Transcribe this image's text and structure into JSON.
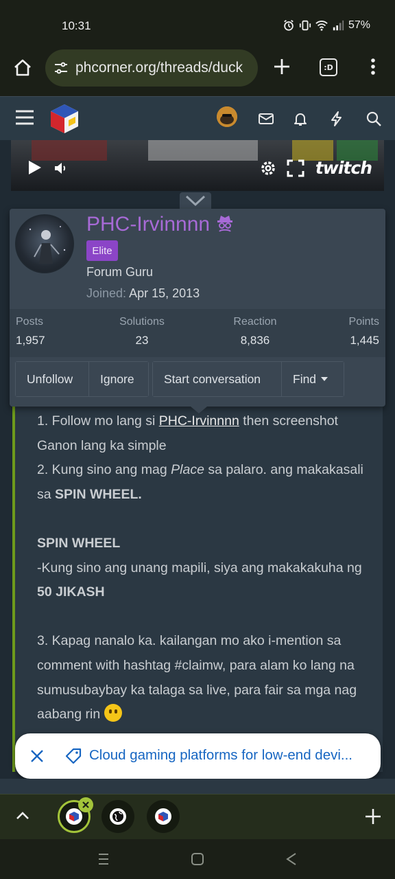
{
  "status": {
    "time": "10:31",
    "battery": "57%"
  },
  "browser": {
    "url": "phcorner.org/threads/duck",
    "tab_icon_label": ":D"
  },
  "video": {
    "brand": "twitch"
  },
  "user_card": {
    "username": "PHC-Irvinnnn",
    "badge": "Elite",
    "title": "Forum Guru",
    "joined_label": "Joined:",
    "joined_date": "Apr 15, 2013",
    "stats": [
      {
        "label": "Posts",
        "value": "1,957"
      },
      {
        "label": "Solutions",
        "value": "23"
      },
      {
        "label": "Reaction",
        "value": "8,836"
      },
      {
        "label": "Points",
        "value": "1,445"
      }
    ],
    "buttons": {
      "unfollow": "Unfollow",
      "ignore": "Ignore",
      "start_conversation": "Start conversation",
      "find": "Find"
    }
  },
  "post": {
    "l1a": "1. Follow mo lang si ",
    "l1_link": "PHC-Irvinnnn",
    "l1b": " then screenshot Ganon lang ka simple",
    "l2a": "2. Kung sino ang mag ",
    "l2_em": "Place",
    "l2b": " sa palaro. ang makakasali sa ",
    "l2_bold": "SPIN WHEEL.",
    "spin_heading": "SPIN WHEEL",
    "spin_a": "-Kung sino ang unang mapili, siya ang makakakuha ng ",
    "spin_bold": "50 JIKASH",
    "l3": "3. Kapag nanalo ka. kailangan mo ako i-mention sa comment with hashtag #claimw, para alam ko lang na sumusubaybay ka talaga sa live, para fair sa mga nag aabang rin "
  },
  "suggestion": {
    "text": "Cloud gaming platforms for low-end devi..."
  },
  "colors": {
    "accent_green": "#a3c43a",
    "username_purple": "#a76ad6",
    "badge_purple": "#8b45c7",
    "post_border": "#6e9b1c",
    "link_blue": "#1766c2"
  }
}
